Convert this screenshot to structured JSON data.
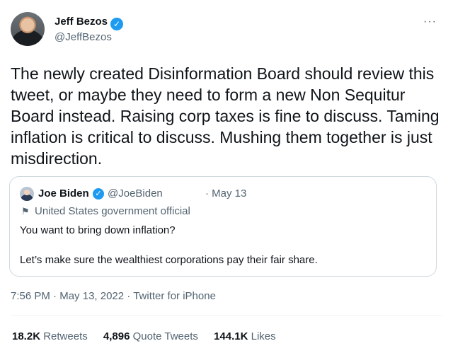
{
  "author": {
    "name": "Jeff Bezos",
    "handle": "@JeffBezos",
    "verified_mark": "✓"
  },
  "menu": {
    "more": "···"
  },
  "tweet": {
    "text": "The newly created Disinformation Board should review this tweet, or maybe they need to form a new Non Sequitur Board instead. Raising corp taxes is fine to discuss. Taming inflation is critical to discuss. Mushing them together is just misdirection."
  },
  "quote": {
    "name": "Joe Biden",
    "verified_mark": "✓",
    "handle": "@JoeBiden",
    "date": "· May 13",
    "label_icon": "⚑",
    "label": "United States government official",
    "line1": "You want to bring down inflation?",
    "line2": "Let’s make sure the wealthiest corporations pay their fair share."
  },
  "meta": {
    "time": "7:56 PM",
    "sep1": " · ",
    "date": "May 13, 2022",
    "sep2": " · ",
    "source": "Twitter for iPhone"
  },
  "stats": {
    "retweets_count": "18.2K",
    "retweets_label": "Retweets",
    "quotes_count": "4,896",
    "quotes_label": "Quote Tweets",
    "likes_count": "144.1K",
    "likes_label": "Likes"
  },
  "colors": {
    "accent": "#1d9bf0",
    "text": "#0f1419",
    "secondary": "#536471",
    "border": "#cfd9de"
  }
}
